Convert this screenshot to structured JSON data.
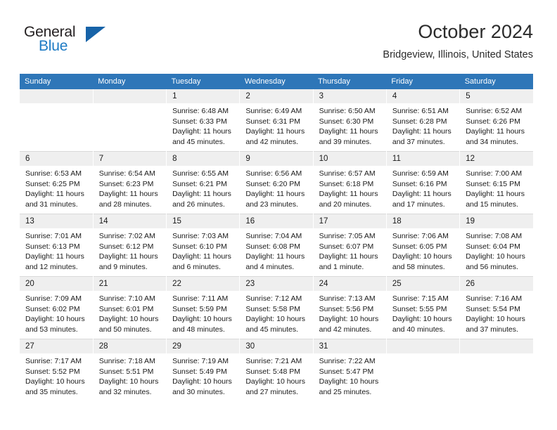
{
  "logo": {
    "word_one": "General",
    "word_two": "Blue",
    "triangle_color": "#1763a8",
    "blue_color": "#1e7bc4"
  },
  "header": {
    "title": "October 2024",
    "subtitle": "Bridgeview, Illinois, United States",
    "header_bg": "#2e76b8",
    "daynum_bg": "#efefef"
  },
  "weekday_headers": [
    "Sunday",
    "Monday",
    "Tuesday",
    "Wednesday",
    "Thursday",
    "Friday",
    "Saturday"
  ],
  "weeks": [
    [
      {
        "day": "",
        "empty": true
      },
      {
        "day": "",
        "empty": true
      },
      {
        "day": "1",
        "sunrise": "Sunrise: 6:48 AM",
        "sunset": "Sunset: 6:33 PM",
        "daylight_line1": "Daylight: 11 hours",
        "daylight_line2": "and 45 minutes."
      },
      {
        "day": "2",
        "sunrise": "Sunrise: 6:49 AM",
        "sunset": "Sunset: 6:31 PM",
        "daylight_line1": "Daylight: 11 hours",
        "daylight_line2": "and 42 minutes."
      },
      {
        "day": "3",
        "sunrise": "Sunrise: 6:50 AM",
        "sunset": "Sunset: 6:30 PM",
        "daylight_line1": "Daylight: 11 hours",
        "daylight_line2": "and 39 minutes."
      },
      {
        "day": "4",
        "sunrise": "Sunrise: 6:51 AM",
        "sunset": "Sunset: 6:28 PM",
        "daylight_line1": "Daylight: 11 hours",
        "daylight_line2": "and 37 minutes."
      },
      {
        "day": "5",
        "sunrise": "Sunrise: 6:52 AM",
        "sunset": "Sunset: 6:26 PM",
        "daylight_line1": "Daylight: 11 hours",
        "daylight_line2": "and 34 minutes."
      }
    ],
    [
      {
        "day": "6",
        "sunrise": "Sunrise: 6:53 AM",
        "sunset": "Sunset: 6:25 PM",
        "daylight_line1": "Daylight: 11 hours",
        "daylight_line2": "and 31 minutes."
      },
      {
        "day": "7",
        "sunrise": "Sunrise: 6:54 AM",
        "sunset": "Sunset: 6:23 PM",
        "daylight_line1": "Daylight: 11 hours",
        "daylight_line2": "and 28 minutes."
      },
      {
        "day": "8",
        "sunrise": "Sunrise: 6:55 AM",
        "sunset": "Sunset: 6:21 PM",
        "daylight_line1": "Daylight: 11 hours",
        "daylight_line2": "and 26 minutes."
      },
      {
        "day": "9",
        "sunrise": "Sunrise: 6:56 AM",
        "sunset": "Sunset: 6:20 PM",
        "daylight_line1": "Daylight: 11 hours",
        "daylight_line2": "and 23 minutes."
      },
      {
        "day": "10",
        "sunrise": "Sunrise: 6:57 AM",
        "sunset": "Sunset: 6:18 PM",
        "daylight_line1": "Daylight: 11 hours",
        "daylight_line2": "and 20 minutes."
      },
      {
        "day": "11",
        "sunrise": "Sunrise: 6:59 AM",
        "sunset": "Sunset: 6:16 PM",
        "daylight_line1": "Daylight: 11 hours",
        "daylight_line2": "and 17 minutes."
      },
      {
        "day": "12",
        "sunrise": "Sunrise: 7:00 AM",
        "sunset": "Sunset: 6:15 PM",
        "daylight_line1": "Daylight: 11 hours",
        "daylight_line2": "and 15 minutes."
      }
    ],
    [
      {
        "day": "13",
        "sunrise": "Sunrise: 7:01 AM",
        "sunset": "Sunset: 6:13 PM",
        "daylight_line1": "Daylight: 11 hours",
        "daylight_line2": "and 12 minutes."
      },
      {
        "day": "14",
        "sunrise": "Sunrise: 7:02 AM",
        "sunset": "Sunset: 6:12 PM",
        "daylight_line1": "Daylight: 11 hours",
        "daylight_line2": "and 9 minutes."
      },
      {
        "day": "15",
        "sunrise": "Sunrise: 7:03 AM",
        "sunset": "Sunset: 6:10 PM",
        "daylight_line1": "Daylight: 11 hours",
        "daylight_line2": "and 6 minutes."
      },
      {
        "day": "16",
        "sunrise": "Sunrise: 7:04 AM",
        "sunset": "Sunset: 6:08 PM",
        "daylight_line1": "Daylight: 11 hours",
        "daylight_line2": "and 4 minutes."
      },
      {
        "day": "17",
        "sunrise": "Sunrise: 7:05 AM",
        "sunset": "Sunset: 6:07 PM",
        "daylight_line1": "Daylight: 11 hours",
        "daylight_line2": "and 1 minute."
      },
      {
        "day": "18",
        "sunrise": "Sunrise: 7:06 AM",
        "sunset": "Sunset: 6:05 PM",
        "daylight_line1": "Daylight: 10 hours",
        "daylight_line2": "and 58 minutes."
      },
      {
        "day": "19",
        "sunrise": "Sunrise: 7:08 AM",
        "sunset": "Sunset: 6:04 PM",
        "daylight_line1": "Daylight: 10 hours",
        "daylight_line2": "and 56 minutes."
      }
    ],
    [
      {
        "day": "20",
        "sunrise": "Sunrise: 7:09 AM",
        "sunset": "Sunset: 6:02 PM",
        "daylight_line1": "Daylight: 10 hours",
        "daylight_line2": "and 53 minutes."
      },
      {
        "day": "21",
        "sunrise": "Sunrise: 7:10 AM",
        "sunset": "Sunset: 6:01 PM",
        "daylight_line1": "Daylight: 10 hours",
        "daylight_line2": "and 50 minutes."
      },
      {
        "day": "22",
        "sunrise": "Sunrise: 7:11 AM",
        "sunset": "Sunset: 5:59 PM",
        "daylight_line1": "Daylight: 10 hours",
        "daylight_line2": "and 48 minutes."
      },
      {
        "day": "23",
        "sunrise": "Sunrise: 7:12 AM",
        "sunset": "Sunset: 5:58 PM",
        "daylight_line1": "Daylight: 10 hours",
        "daylight_line2": "and 45 minutes."
      },
      {
        "day": "24",
        "sunrise": "Sunrise: 7:13 AM",
        "sunset": "Sunset: 5:56 PM",
        "daylight_line1": "Daylight: 10 hours",
        "daylight_line2": "and 42 minutes."
      },
      {
        "day": "25",
        "sunrise": "Sunrise: 7:15 AM",
        "sunset": "Sunset: 5:55 PM",
        "daylight_line1": "Daylight: 10 hours",
        "daylight_line2": "and 40 minutes."
      },
      {
        "day": "26",
        "sunrise": "Sunrise: 7:16 AM",
        "sunset": "Sunset: 5:54 PM",
        "daylight_line1": "Daylight: 10 hours",
        "daylight_line2": "and 37 minutes."
      }
    ],
    [
      {
        "day": "27",
        "sunrise": "Sunrise: 7:17 AM",
        "sunset": "Sunset: 5:52 PM",
        "daylight_line1": "Daylight: 10 hours",
        "daylight_line2": "and 35 minutes."
      },
      {
        "day": "28",
        "sunrise": "Sunrise: 7:18 AM",
        "sunset": "Sunset: 5:51 PM",
        "daylight_line1": "Daylight: 10 hours",
        "daylight_line2": "and 32 minutes."
      },
      {
        "day": "29",
        "sunrise": "Sunrise: 7:19 AM",
        "sunset": "Sunset: 5:49 PM",
        "daylight_line1": "Daylight: 10 hours",
        "daylight_line2": "and 30 minutes."
      },
      {
        "day": "30",
        "sunrise": "Sunrise: 7:21 AM",
        "sunset": "Sunset: 5:48 PM",
        "daylight_line1": "Daylight: 10 hours",
        "daylight_line2": "and 27 minutes."
      },
      {
        "day": "31",
        "sunrise": "Sunrise: 7:22 AM",
        "sunset": "Sunset: 5:47 PM",
        "daylight_line1": "Daylight: 10 hours",
        "daylight_line2": "and 25 minutes."
      },
      {
        "day": "",
        "empty": true
      },
      {
        "day": "",
        "empty": true
      }
    ]
  ]
}
